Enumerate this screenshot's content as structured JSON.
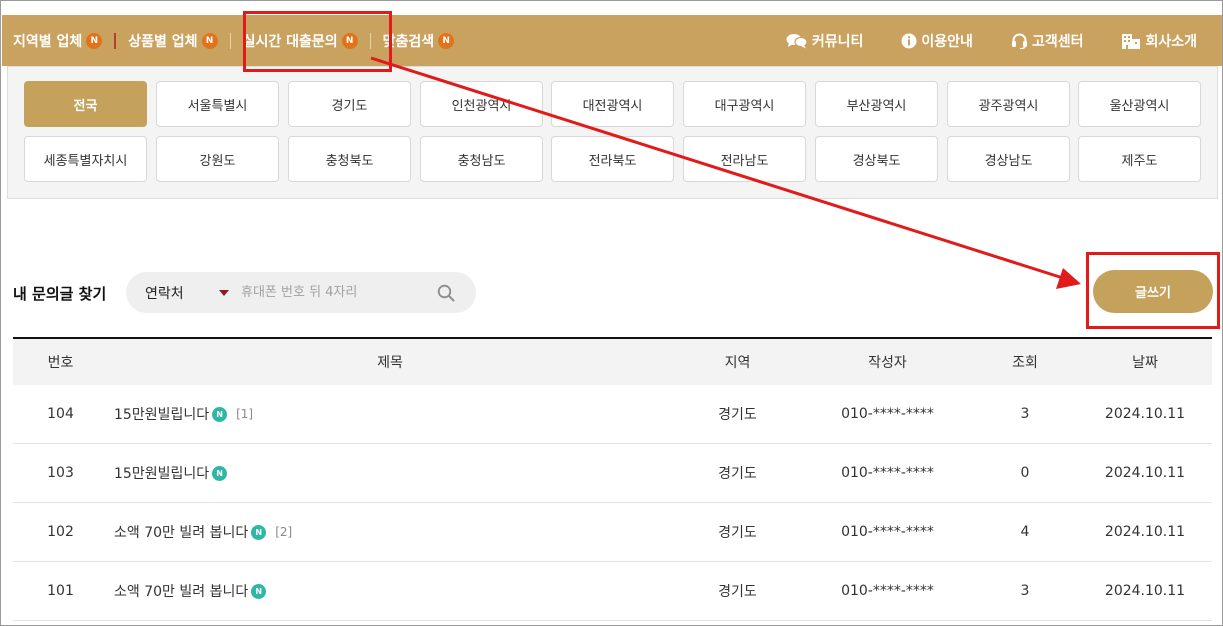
{
  "nav": {
    "left": [
      {
        "label": "지역별 업체",
        "badge": "N"
      },
      {
        "label": "상품별 업체",
        "badge": "N"
      },
      {
        "label": "실시간 대출문의",
        "badge": "N"
      },
      {
        "label": "맞춤검색",
        "badge": "N"
      }
    ],
    "right": [
      {
        "label": "커뮤니티",
        "icon": "chat-icon"
      },
      {
        "label": "이용안내",
        "icon": "info-icon"
      },
      {
        "label": "고객센터",
        "icon": "headset-icon"
      },
      {
        "label": "회사소개",
        "icon": "building-icon"
      }
    ]
  },
  "regions": {
    "row1": [
      "전국",
      "서울특별시",
      "경기도",
      "인천광역시",
      "대전광역시",
      "대구광역시",
      "부산광역시",
      "광주광역시",
      "울산광역시"
    ],
    "row2": [
      "세종특별자치시",
      "강원도",
      "충청북도",
      "충청남도",
      "전라북도",
      "전라남도",
      "경상북도",
      "경상남도",
      "제주도"
    ],
    "active": "전국"
  },
  "search": {
    "label": "내 문의글 찾기",
    "select_value": "연락처",
    "placeholder": "휴대폰 번호 뒤 4자리"
  },
  "write_button": "글쓰기",
  "table": {
    "headers": {
      "no": "번호",
      "title": "제목",
      "region": "지역",
      "author": "작성자",
      "views": "조회",
      "date": "날짜"
    },
    "rows": [
      {
        "no": "104",
        "title": "15만원빌립니다",
        "badge": "N",
        "comments": "[1]",
        "region": "경기도",
        "author": "010-****-****",
        "views": "3",
        "date": "2024.10.11"
      },
      {
        "no": "103",
        "title": "15만원빌립니다",
        "badge": "N",
        "comments": "",
        "region": "경기도",
        "author": "010-****-****",
        "views": "0",
        "date": "2024.10.11"
      },
      {
        "no": "102",
        "title": "소액 70만 빌려 봅니다",
        "badge": "N",
        "comments": "[2]",
        "region": "경기도",
        "author": "010-****-****",
        "views": "4",
        "date": "2024.10.11"
      },
      {
        "no": "101",
        "title": "소액 70만 빌려 봅니다",
        "badge": "N",
        "comments": "",
        "region": "경기도",
        "author": "010-****-****",
        "views": "3",
        "date": "2024.10.11"
      }
    ]
  },
  "colors": {
    "brand_gold": "#c9a25f",
    "badge_orange": "#e2731b",
    "badge_teal": "#2fb7a5",
    "annotation_red": "#e11a1a"
  }
}
